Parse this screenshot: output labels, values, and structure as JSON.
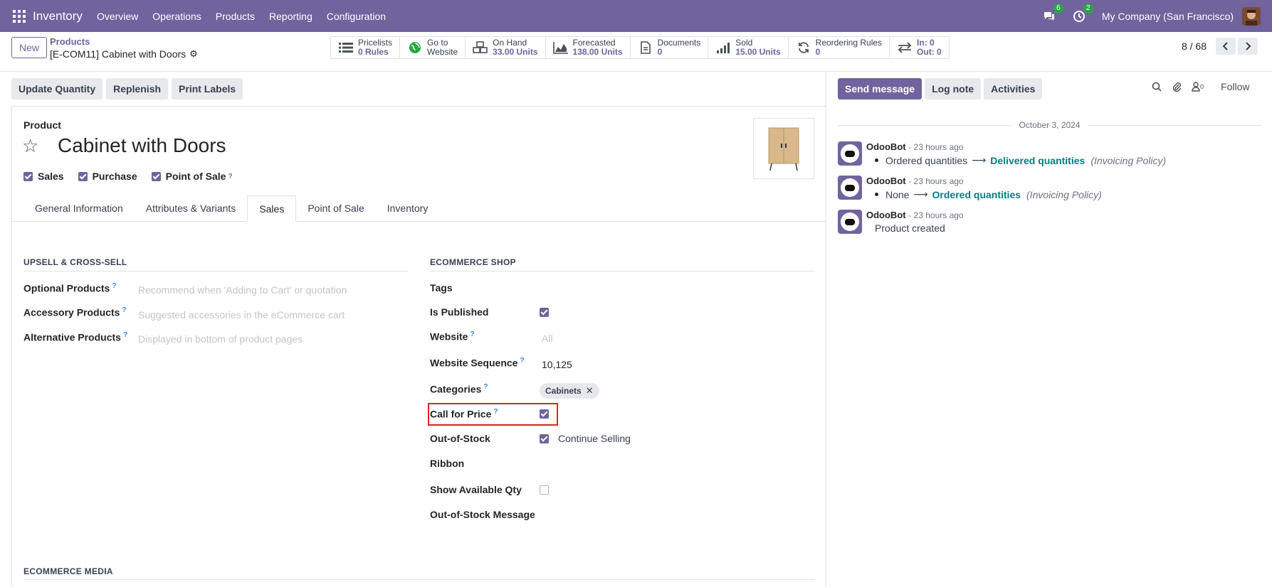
{
  "navbar": {
    "app_name": "Inventory",
    "menu": [
      "Overview",
      "Operations",
      "Products",
      "Reporting",
      "Configuration"
    ],
    "messages_badge": "6",
    "activities_badge": "2",
    "company": "My Company (San Francisco)"
  },
  "control": {
    "new_label": "New",
    "breadcrumb": "Products",
    "record": "[E-COM11] Cabinet with Doors",
    "smart_buttons": [
      {
        "label": "Pricelists",
        "value": "0 Rules",
        "icon": "list-icon"
      },
      {
        "label": "Go to",
        "value": "Website",
        "icon": "globe-icon"
      },
      {
        "label": "On Hand",
        "value": "33.00 Units",
        "icon": "boxes-icon"
      },
      {
        "label": "Forecasted",
        "value": "138.00 Units",
        "icon": "area-chart-icon"
      },
      {
        "label": "Documents",
        "value": "0",
        "icon": "file-icon"
      },
      {
        "label": "Sold",
        "value": "15.00 Units",
        "icon": "signal-icon"
      },
      {
        "label": "Reordering Rules",
        "value": "0",
        "icon": "refresh-icon"
      },
      {
        "label": "In: 0",
        "value": "Out: 0",
        "icon": "exchange-icon"
      }
    ],
    "pager": "8 / 68"
  },
  "actions": [
    "Update Quantity",
    "Replenish",
    "Print Labels"
  ],
  "form": {
    "product_label": "Product",
    "title": "Cabinet with Doors",
    "checks": [
      {
        "label": "Sales",
        "checked": true,
        "tip": false
      },
      {
        "label": "Purchase",
        "checked": true,
        "tip": false
      },
      {
        "label": "Point of Sale",
        "checked": true,
        "tip": true
      }
    ],
    "tabs": [
      "General Information",
      "Attributes & Variants",
      "Sales",
      "Point of Sale",
      "Inventory"
    ],
    "active_tab": "Sales",
    "upsell": {
      "title": "UPSELL & CROSS-SELL",
      "optional_label": "Optional Products",
      "optional_ph": "Recommend when 'Adding to Cart' or quotation",
      "accessory_label": "Accessory Products",
      "accessory_ph": "Suggested accessories in the eCommerce cart",
      "alternative_label": "Alternative Products",
      "alternative_ph": "Displayed in bottom of product pages"
    },
    "ecommerce": {
      "title": "ECOMMERCE SHOP",
      "tags_label": "Tags",
      "published_label": "Is Published",
      "website_label": "Website",
      "website_ph": "All",
      "sequence_label": "Website Sequence",
      "sequence_value": "10,125",
      "categories_label": "Categories",
      "category_tag": "Cabinets",
      "call_price_label": "Call for Price",
      "oos_label": "Out-of-Stock",
      "oos_value": "Continue Selling",
      "ribbon_label": "Ribbon",
      "show_qty_label": "Show Available Qty",
      "oos_msg_label": "Out-of-Stock Message"
    },
    "media_title": "ECOMMERCE MEDIA",
    "tip_mark": "?"
  },
  "chatter": {
    "send_message": "Send message",
    "log_note": "Log note",
    "activities": "Activities",
    "followers_count": "0",
    "follow": "Follow",
    "date": "October 3, 2024",
    "messages": [
      {
        "author": "OdooBot",
        "time": "- 23 hours ago",
        "old": "Ordered quantities",
        "new": "Delivered quantities",
        "field": "(Invoicing Policy)"
      },
      {
        "author": "OdooBot",
        "time": "- 23 hours ago",
        "old": "None",
        "new": "Ordered quantities",
        "field": "(Invoicing Policy)"
      },
      {
        "author": "OdooBot",
        "time": "- 23 hours ago",
        "text": "Product created"
      }
    ]
  }
}
